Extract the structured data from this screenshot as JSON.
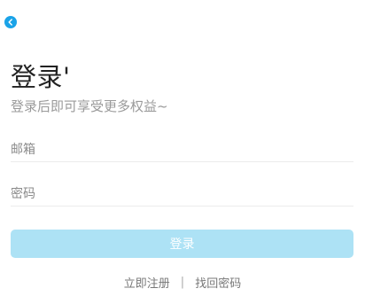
{
  "header": {
    "back_icon": "chevron-left-icon",
    "accent_color": "#1aa3e8"
  },
  "title": "登录'",
  "subtitle": "登录后即可享受更多权益~",
  "form": {
    "email_placeholder": "邮箱",
    "password_placeholder": "密码"
  },
  "login_button": {
    "label": "登录",
    "color": "#ade2f5"
  },
  "links": {
    "register": "立即注册",
    "separator": "|",
    "forgot_password": "找回密码"
  }
}
